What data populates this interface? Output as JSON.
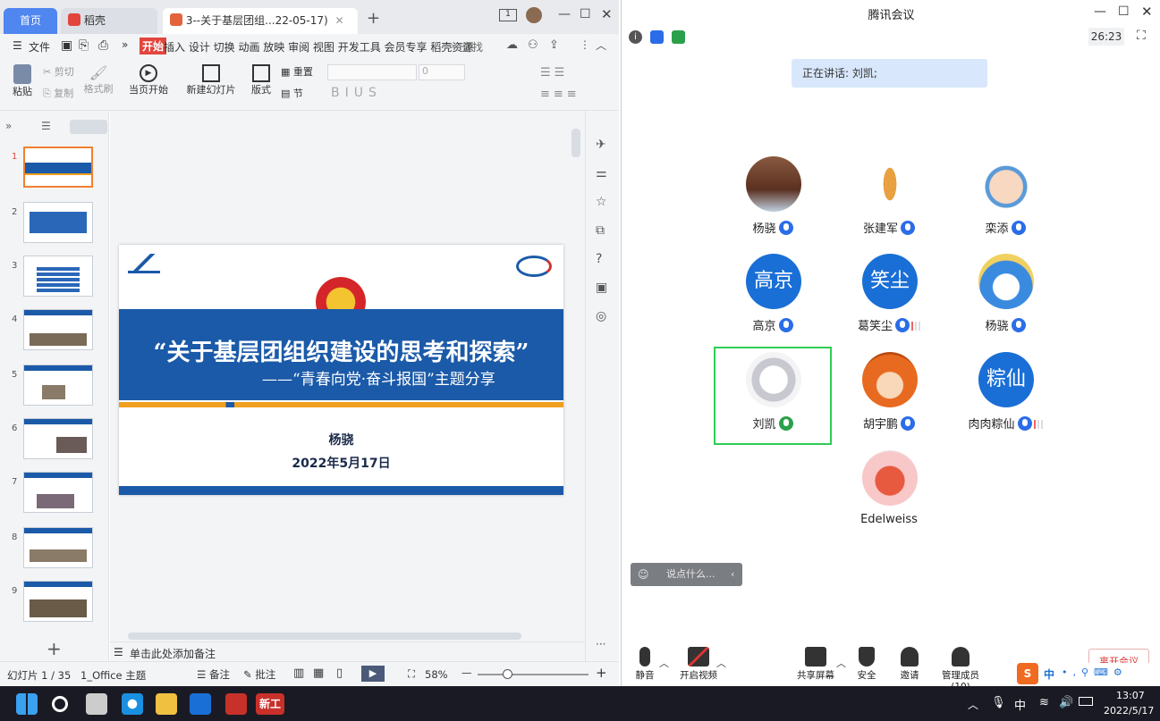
{
  "wps": {
    "tabs": {
      "home": "首页",
      "daoke": "稻壳",
      "doc": "3--关于基层团组...22-05-17)"
    },
    "menu": {
      "file": "文件",
      "start": "开始",
      "items": "插入 设计 切换 动画 放映 审阅 视图 开发工具 会员专享 稻壳资源",
      "search": "查找"
    },
    "tools": {
      "paste": "粘贴",
      "cut": "剪切",
      "copy": "复制",
      "format_painter": "格式刷",
      "play_from_current": "当页开始",
      "new_slide": "新建幻灯片",
      "layout": "版式",
      "reset": "重置",
      "section": "节",
      "font_size": "0"
    },
    "slide": {
      "title": "“关于基层团组织建设的思考和探索”",
      "subtitle": "——“青春向党·奋斗报国”主题分享",
      "author": "杨骁",
      "date": "2022年5月17日"
    },
    "thumbnails": [
      "1",
      "2",
      "3",
      "4",
      "5",
      "6",
      "7",
      "8",
      "9"
    ],
    "notes_placeholder": "单击此处添加备注",
    "status": {
      "slide_count": "幻灯片 1 / 35",
      "theme": "1_Office 主题",
      "notes": "备注",
      "comments": "批注",
      "zoom": "58%"
    }
  },
  "meeting": {
    "title": "腾讯会议",
    "timer": "26:23",
    "speaking": "正在讲话: 刘凯;",
    "participants": [
      {
        "name": "杨骁",
        "avatar_text": ""
      },
      {
        "name": "张建军",
        "avatar_text": ""
      },
      {
        "name": "栾添",
        "avatar_text": ""
      },
      {
        "name": "高京",
        "avatar_text": "高京"
      },
      {
        "name": "葛笑尘",
        "avatar_text": "笑尘"
      },
      {
        "name": "杨骁",
        "avatar_text": ""
      },
      {
        "name": "刘凯",
        "avatar_text": ""
      },
      {
        "name": "胡宇鹏",
        "avatar_text": ""
      },
      {
        "name": "肉肉粽仙",
        "avatar_text": "粽仙"
      },
      {
        "name": "Edelweiss",
        "avatar_text": ""
      }
    ],
    "chat_placeholder": "说点什么...",
    "controls": {
      "mute": "静音",
      "video": "开启视频",
      "share": "共享屏幕",
      "security": "安全",
      "invite": "邀请",
      "members": "管理成员(10)",
      "leave": "离开会议"
    }
  },
  "taskbar": {
    "wps_label": "新工",
    "ime": "中",
    "time": "13:07",
    "date": "2022/5/17"
  },
  "colors": {
    "accent_blue": "#1a6fd6",
    "slide_blue": "#1b5aa8",
    "slide_orange": "#f0a020",
    "wps_red": "#e2453c"
  }
}
